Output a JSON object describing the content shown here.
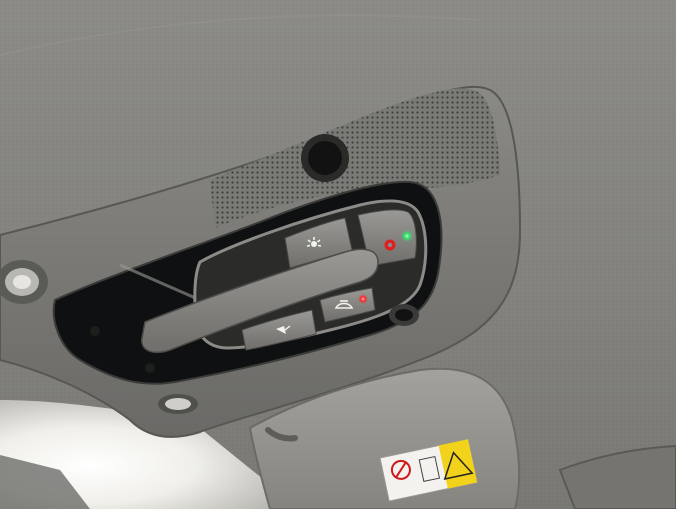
{
  "scene": {
    "subject": "car-overhead-console",
    "colors": {
      "headliner": "#8e8d89",
      "headliner_dark": "#5f5e5a",
      "console_frame": "#7a7975",
      "console_recess": "#1c1d1e",
      "glass_black": "#0d0e10",
      "button_face": "#8a8a86",
      "button_edge": "#4a4a47",
      "sun_visor": "#9a9994",
      "window_glare": "#f4f4f0",
      "led_green": "#2fe36a",
      "led_red": "#ff2a2a",
      "sos_red": "#e02020",
      "warning_yellow": "#f2d21b"
    }
  },
  "controls": {
    "interior_light_button": {
      "icon": "interior-light-icon"
    },
    "sos_button": {
      "icon": "sos-icon",
      "led": "green"
    },
    "sunroof_button": {
      "icon": "sunroof-icon",
      "led": "red"
    },
    "reading_light_button": {
      "icon": "reading-light-icon"
    },
    "sunroof_rocker_switch": {
      "icon": "rocker-switch"
    }
  },
  "details": {
    "microphone": {
      "icon": "microphone-icon"
    },
    "left_reading_lamp": {
      "icon": "lamp-icon"
    },
    "lower_lamp": {
      "icon": "lamp-icon"
    },
    "right_sensor": {
      "icon": "sensor-icon"
    },
    "visor_label": {
      "icon": "airbag-warning-label"
    }
  }
}
